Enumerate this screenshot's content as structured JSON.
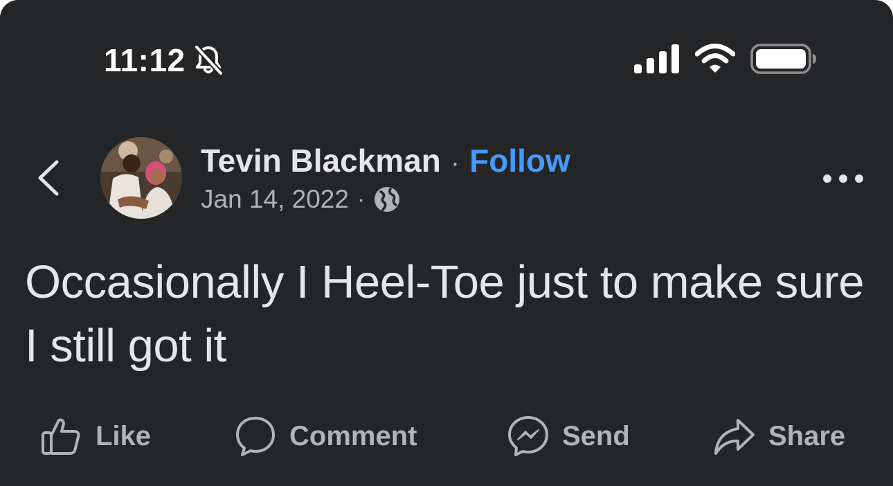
{
  "status_bar": {
    "time": "11:12",
    "icons": [
      "bell-slash-icon",
      "signal-icon",
      "wifi-icon",
      "battery-icon"
    ]
  },
  "post": {
    "author": "Tevin Blackman",
    "separator": "·",
    "follow_label": "Follow",
    "date": "Jan 14, 2022",
    "audience_icon": "globe-icon",
    "text": "Occasionally I Heel-Toe just to make sure I still got it"
  },
  "actions": {
    "like": "Like",
    "comment": "Comment",
    "send": "Send",
    "share": "Share"
  },
  "colors": {
    "background": "#242526",
    "text_primary": "#e4e6eb",
    "text_secondary": "#b0b3b8",
    "link": "#4599ff"
  }
}
